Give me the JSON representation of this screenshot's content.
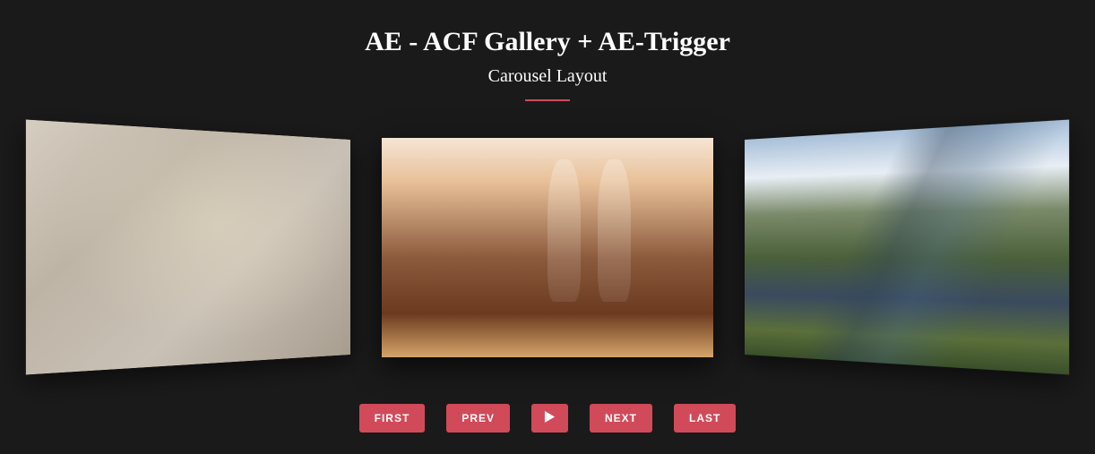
{
  "header": {
    "title": "AE - ACF Gallery + AE-Trigger",
    "subtitle": "Carousel Layout"
  },
  "carousel": {
    "slides": [
      {
        "name": "slide-person"
      },
      {
        "name": "slide-food-drinks"
      },
      {
        "name": "slide-mountains"
      }
    ]
  },
  "controls": {
    "first_label": "FIRST",
    "prev_label": "PREV",
    "play_icon": "play-icon",
    "next_label": "NEXT",
    "last_label": "LAST"
  },
  "colors": {
    "background": "#1a1a1a",
    "accent": "#d14a5a",
    "text": "#ffffff"
  }
}
